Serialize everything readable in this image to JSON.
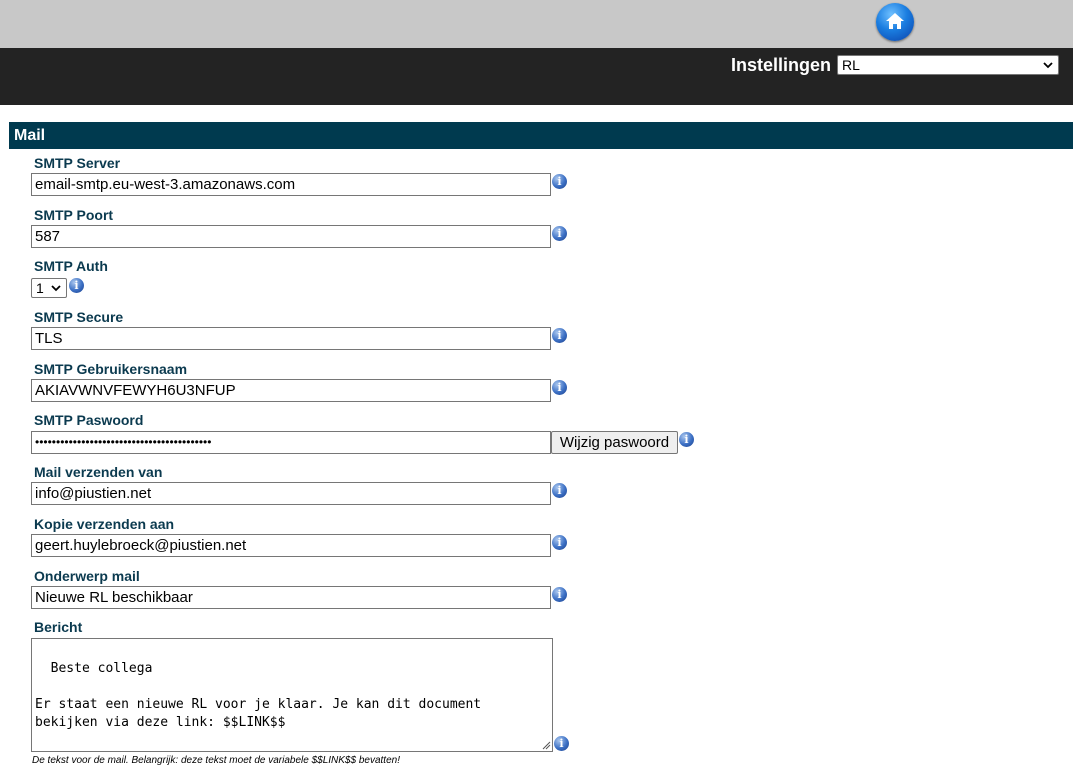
{
  "header": {
    "home_icon": "home-icon",
    "settings_label": "Instellingen",
    "settings_value": "RL"
  },
  "section": {
    "title": "Mail"
  },
  "fields": {
    "smtp_server": {
      "label": "SMTP Server",
      "value": "email-smtp.eu-west-3.amazonaws.com"
    },
    "smtp_port": {
      "label": "SMTP Poort",
      "value": "587"
    },
    "smtp_auth": {
      "label": "SMTP Auth",
      "value": "1"
    },
    "smtp_secure": {
      "label": "SMTP Secure",
      "value": "TLS"
    },
    "smtp_user": {
      "label": "SMTP Gebruikersnaam",
      "value": "AKIAVWNVFEWYH6U3NFUP"
    },
    "smtp_password": {
      "label": "SMTP Paswoord",
      "value": "••••••••••••••••••••••••••••••••••••••••••",
      "button_label": "Wijzig paswoord"
    },
    "mail_from": {
      "label": "Mail verzenden van",
      "value": "info@piustien.net"
    },
    "mail_cc": {
      "label": "Kopie verzenden aan",
      "value": "geert.huylebroeck@piustien.net"
    },
    "mail_subject": {
      "label": "Onderwerp mail",
      "value": "Nieuwe RL beschikbaar"
    },
    "message": {
      "label": "Bericht",
      "value": "Beste collega\n\nEr staat een nieuwe RL voor je klaar. Je kan dit document bekijken via deze link: $$LINK$$\n\nDe personeelsdienst",
      "help": "De tekst voor de mail. Belangrijk: deze tekst moet de variabele $$LINK$$ bevatten!"
    }
  },
  "colors": {
    "topbar": "#c8c8c8",
    "darkbar": "#232323",
    "section_header": "#003a4f",
    "label_text": "#0b3a4f"
  }
}
